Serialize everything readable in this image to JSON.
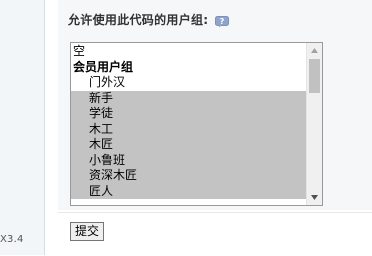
{
  "sidebar": {
    "version_text": "X3.4"
  },
  "form": {
    "label": "允许使用此代码的用户组:",
    "help_icon": "help-icon",
    "submit_label": "提交"
  },
  "usergroups": {
    "options": [
      {
        "label": "空",
        "type": "plain",
        "selected": false
      },
      {
        "label": "会员用户组",
        "type": "group",
        "selected": false
      },
      {
        "label": "门外汉",
        "type": "child",
        "selected": false
      },
      {
        "label": "新手",
        "type": "child",
        "selected": true
      },
      {
        "label": "学徒",
        "type": "child",
        "selected": true
      },
      {
        "label": "木工",
        "type": "child",
        "selected": true
      },
      {
        "label": "木匠",
        "type": "child",
        "selected": true
      },
      {
        "label": "小鲁班",
        "type": "child",
        "selected": true
      },
      {
        "label": "资深木匠",
        "type": "child",
        "selected": true
      },
      {
        "label": "匠人",
        "type": "child",
        "selected": true
      }
    ]
  },
  "colors": {
    "selected_bg": "#c3c3c3",
    "panel_bg": "#f5f7f9",
    "icon_blue": "#8fa4cc"
  }
}
